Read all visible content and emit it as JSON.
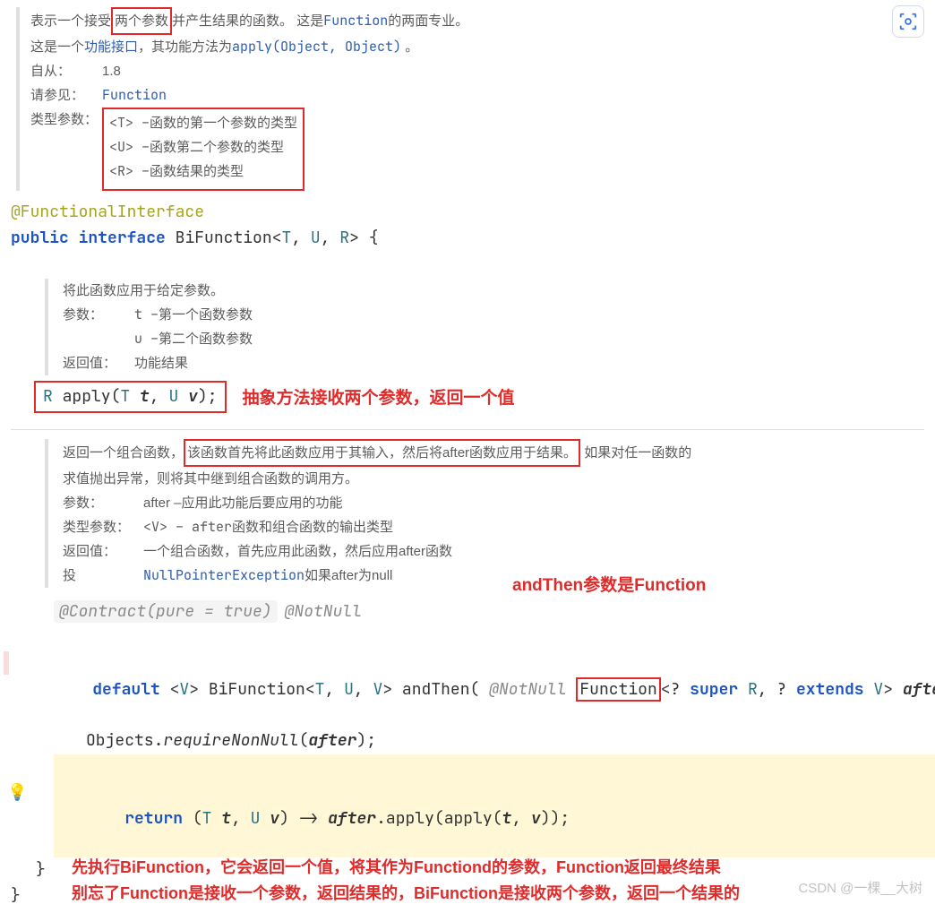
{
  "lens_icon": "lens-icon",
  "top": {
    "line1_pre": "表示一个接受",
    "line1_hl": "两个参数",
    "line1_post": "并产生结果的函数。 这是",
    "line1_link": "Function",
    "line1_tail": "的两面专业。",
    "line2_pre": "这是一个",
    "line2_link1": "功能接口",
    "line2_mid": "，其功能方法为",
    "line2_link2": "apply(Object, Object)",
    "line2_tail": " 。",
    "since_lbl": "自从：",
    "since_val": "1.8",
    "see_lbl": "请参见：",
    "see_val": "Function",
    "type_lbl": "类型参数：",
    "type_t": "<T> –函数的第一个参数的类型",
    "type_u": "<U> –函数第二个参数的类型",
    "type_r": "<R> –函数结果的类型"
  },
  "decl": {
    "ann": "@FunctionalInterface",
    "kw1": "public",
    "kw2": "interface",
    "name": "BiFunction",
    "open": "<",
    "t": "T",
    "c1": ", ",
    "u": "U",
    "c2": ", ",
    "r": "R",
    "close": "> {"
  },
  "apply_doc": {
    "line1": "将此函数应用于给定参数。",
    "param_lbl": "参数：",
    "param_t": "t –第一个函数参数",
    "param_u": "u –第二个函数参数",
    "ret_lbl": "返回值：",
    "ret_val": "功能结果"
  },
  "apply_sig": {
    "r": "R",
    "name": " apply(",
    "t": "T",
    "sp1": " ",
    "pt": "t",
    "c1": ", ",
    "u": "U",
    "sp2": " ",
    "pu": "v",
    "end": ");"
  },
  "apply_note": "抽象方法接收两个参数，返回一个值",
  "andthen_doc": {
    "line1_pre": "返回一个组合函数，",
    "line1_hl": "该函数首先将此函数应用于其输入，然后将after函数应用于结果。",
    "line1_post": " 如果对任一函数的",
    "line2": "求值抛出异常，则将其中继到组合函数的调用方。",
    "param_lbl": "参数：",
    "param_val": "after –应用此功能后要应用的功能",
    "type_lbl": "类型参数：",
    "type_val": "<V> – after函数和组合函数的输出类型",
    "ret_lbl": "返回值：",
    "ret_val": "一个组合函数，首先应用此函数，然后应用after函数",
    "throw_lbl": "投",
    "throw_val_pre": "NullPointerException",
    "throw_val_post": "如果after为null"
  },
  "andthen_note": "andThen参数是Function",
  "andthen_code": {
    "contract": "@Contract(pure = true)",
    "notnull_top": "@NotNull",
    "kw_default": "default",
    "open_g": " <",
    "v": "V",
    "close_g": "> ",
    "ret_type": "BiFunction",
    "ret_open": "<",
    "t": "T",
    "c1": ", ",
    "u": "U",
    "c2": ", ",
    "v2": "V",
    "ret_close": "> ",
    "name": "andThen",
    "paren_open": "( ",
    "notnull_param": "@NotNull",
    "sp": " ",
    "func": "Function",
    "paramtype": "<? ",
    "super": "super",
    "sp_r": " ",
    "r": "R",
    "c3": ", ? ",
    "extends": "extends",
    "sp_v": " ",
    "v3": "V",
    "close2": "> ",
    "after": "after",
    "paren_close": ") {",
    "body1_pre": "Objects.",
    "body1_call": "requireNonNull",
    "body1_arg": "(",
    "body1_after": "after",
    "body1_end": ");",
    "body2_kw": "return",
    "body2_open": " (",
    "body2_t": "T",
    "body2_sp1": " ",
    "body2_pt": "t",
    "body2_c": ", ",
    "body2_u": "U",
    "body2_sp2": " ",
    "body2_pu": "v",
    "body2_arrow": ") -> ",
    "body2_after": "after",
    "body2_dot": ".apply(apply(",
    "body2_t2": "t",
    "body2_c2": ", ",
    "body2_u2": "v",
    "body2_end": "));",
    "brace1": "}",
    "brace2": "}"
  },
  "bottom_note1": "先执行BiFunction，它会返回一个值，将其作为Functiond的参数，Function返回最终结果",
  "bottom_note2": "别忘了Function是接收一个参数，返回结果的，BiFunction是接收两个参数，返回一个结果的",
  "watermark": "CSDN @一棵__大树"
}
